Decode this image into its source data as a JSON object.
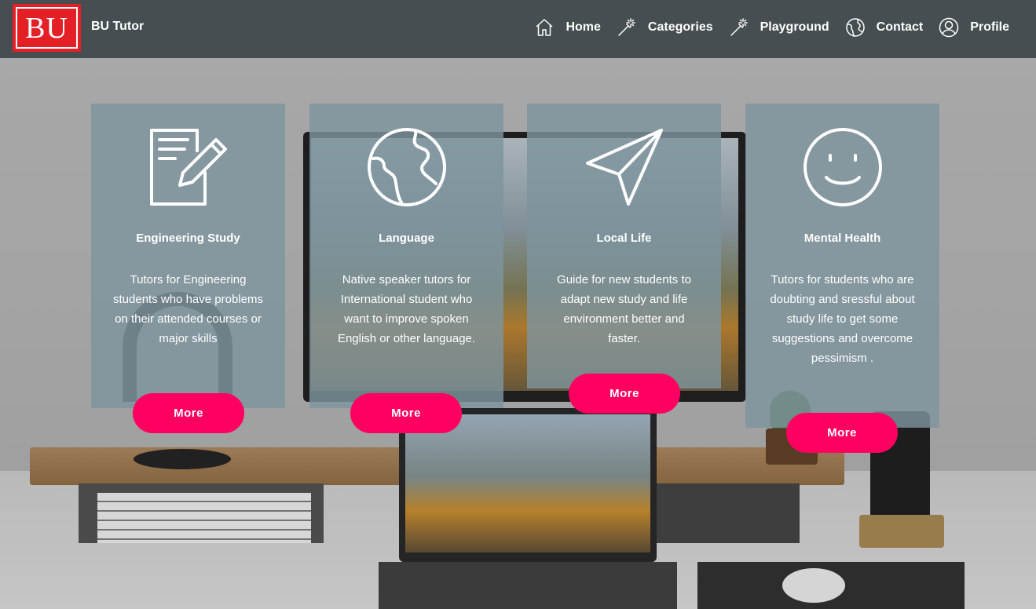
{
  "header": {
    "logo_text": "BU",
    "brand": "BU Tutor",
    "nav": [
      {
        "label": "Home",
        "icon": "home-icon"
      },
      {
        "label": "Categories",
        "icon": "magic-wand-icon"
      },
      {
        "label": "Playground",
        "icon": "magic-wand-icon"
      },
      {
        "label": "Contact",
        "icon": "globe-icon"
      },
      {
        "label": "Profile",
        "icon": "user-circle-icon"
      }
    ]
  },
  "cards": [
    {
      "title": "Engineering Study",
      "icon": "document-edit-icon",
      "description": "Tutors for Engineering students who have problems on their attended courses or major skills",
      "button": "More"
    },
    {
      "title": "Language",
      "icon": "globe-icon",
      "description": "Native speaker tutors for International student who want to  improve spoken English or other language.",
      "button": "More"
    },
    {
      "title": "Local Life",
      "icon": "paper-plane-icon",
      "description": "Guide for new students to adapt new study and life environment better and faster.",
      "button": "More"
    },
    {
      "title": "Mental Health",
      "icon": "smiley-icon",
      "description": "Tutors for students who are doubting and sressful about study life to get some suggestions and overcome pessimism .",
      "button": "More"
    }
  ],
  "colors": {
    "header_bg": "#464e51",
    "logo_red": "#e41f26",
    "card_bg": "rgba(126,148,158,0.82)",
    "button": "#ff0060"
  }
}
